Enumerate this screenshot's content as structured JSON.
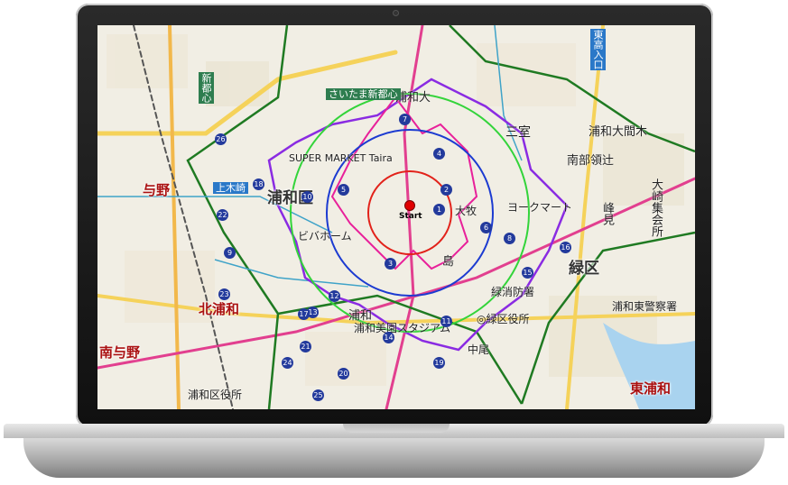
{
  "map": {
    "start_label": "Start",
    "areas": {
      "urawa_ku": "浦和区",
      "midori_ku": "緑区",
      "kita_urawa": "北浦和",
      "minami_yono": "南与野",
      "higashi_urawa": "東浦和",
      "yono": "与野",
      "urawa_higashi_ku": "浦和大",
      "misono": "三室",
      "nanbu_ryoushi": "南部領辻",
      "oomaki": "大崎集会所",
      "kidouji": "峰見",
      "urawa": "浦和"
    },
    "stores": {
      "super_market": "SUPER MARKET Taira",
      "vivahome": "ビバホーム",
      "york_mart": "ヨークマート",
      "urawa_stadium": "浦和美園スタジアム"
    },
    "stations": {
      "saitama_shintoshin": "さいたま新都心",
      "kamikizaki": "上木崎",
      "shinbashi": "新都心",
      "higashi_takasaki": "東高入口",
      "urawa_ohto": "浦和大間木"
    },
    "facilities": {
      "midori_ward_office": "◎緑区役所",
      "midori_fire": "緑消防署",
      "urawa_higashi_police": "浦和東警察署",
      "urawa_ward_office": "浦和区役所",
      "shimizu": "島",
      "nakao": "中尾",
      "akabane": "大牧",
      "urawa_oomaki": "浦和大間木"
    },
    "colors": {
      "radius_inner": "#e2221a",
      "radius_mid": "#1c3bd1",
      "radius_outer": "#33d43a",
      "trade_area_pink": "#e8209a",
      "trade_area_purple": "#8a2be2",
      "boundary_green": "#1f7a22",
      "start_marker": "#e00000",
      "store_badge": "#233a9c"
    },
    "badge_numbers": [
      "1",
      "2",
      "3",
      "4",
      "5",
      "6",
      "7",
      "8",
      "9",
      "10",
      "11",
      "12",
      "13",
      "14",
      "15",
      "16",
      "17",
      "18",
      "19",
      "20",
      "21",
      "22",
      "23",
      "24",
      "25",
      "26"
    ]
  }
}
